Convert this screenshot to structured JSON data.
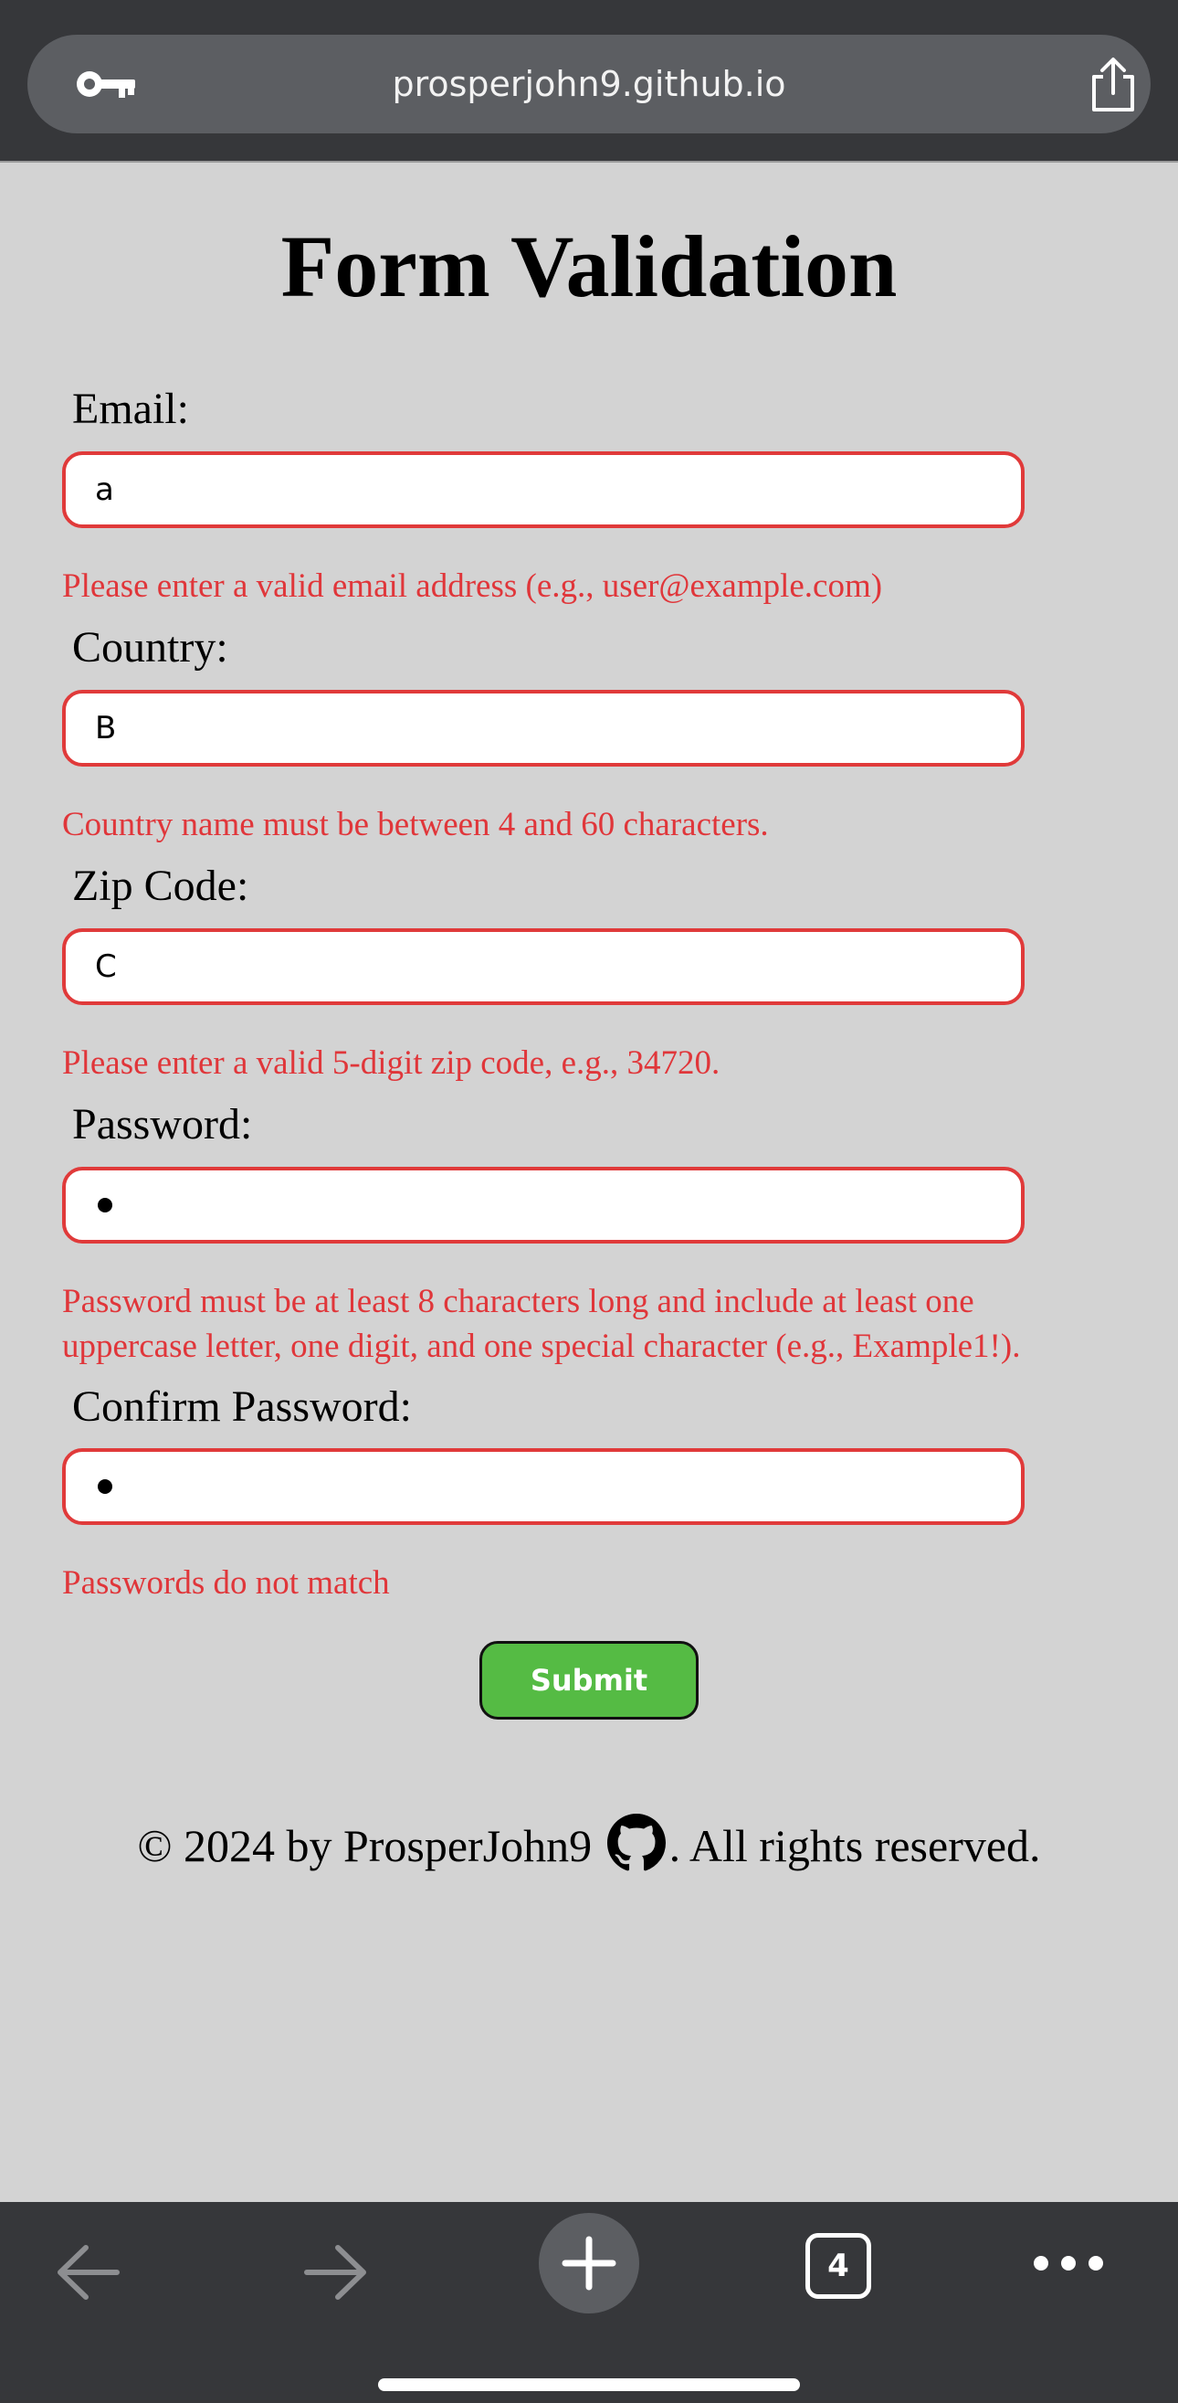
{
  "browser": {
    "url": "prosperjohn9.github.io",
    "tab_count": "4"
  },
  "page": {
    "title": "Form Validation",
    "fields": {
      "email": {
        "label": "Email:",
        "value": "a",
        "error": "Please enter a valid email address (e.g., user@example.com)"
      },
      "country": {
        "label": "Country:",
        "value": "B",
        "error": "Country name must be between 4 and 60 characters."
      },
      "zip": {
        "label": "Zip Code:",
        "value": "C",
        "error": "Please enter a valid 5-digit zip code, e.g., 34720."
      },
      "password": {
        "label": "Password:",
        "masked_length": 1,
        "error_line1": "Password must be at least 8 characters long and include at least one",
        "error_line2": "uppercase letter, one digit, and one special character (e.g., Example1!)."
      },
      "confirm": {
        "label": "Confirm Password:",
        "masked_length": 1,
        "error": "Passwords do not match"
      }
    },
    "submit_label": "Submit",
    "footer": {
      "before": "© 2024 by ProsperJohn9",
      "after": ". All rights reserved.",
      "icon": "github-icon"
    }
  },
  "colors": {
    "error": "#e0363a",
    "submit_bg": "#55bb44",
    "page_bg": "#d3d3d3"
  }
}
